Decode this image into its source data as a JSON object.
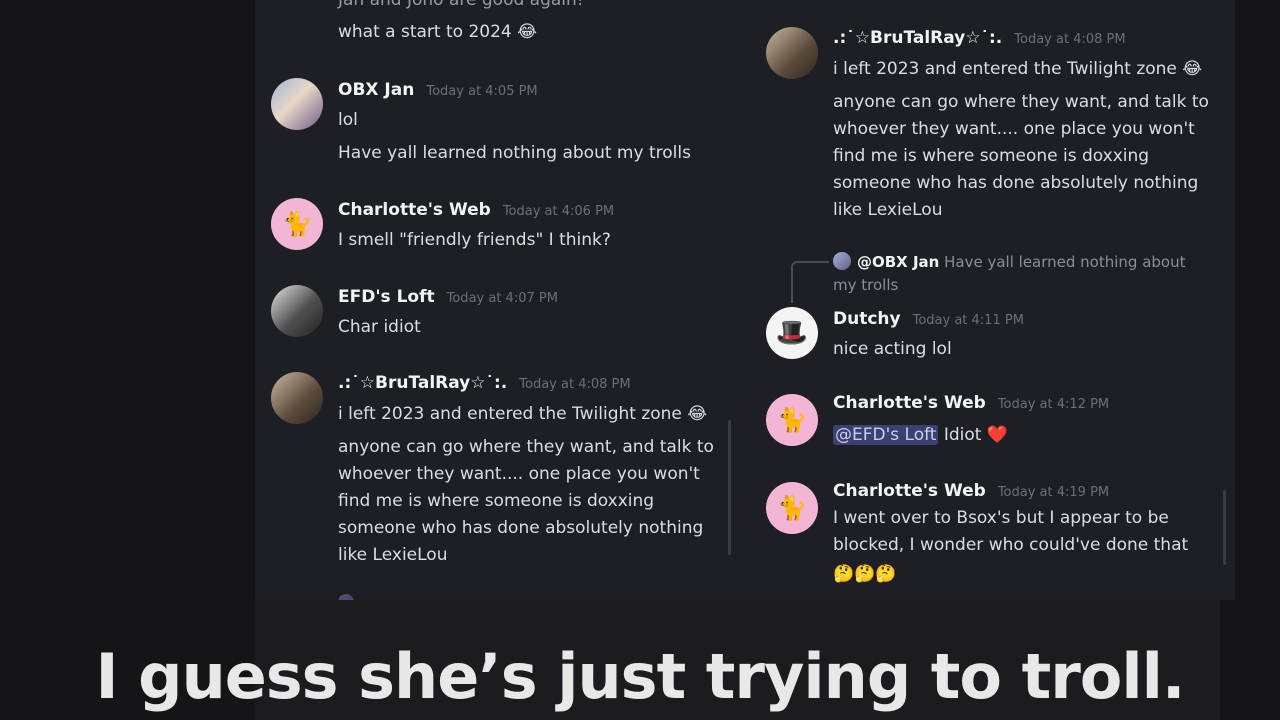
{
  "left_panel": {
    "top_partial": {
      "line1": "Jan and Jono are good again!",
      "line2": "what a start to 2024 😂"
    },
    "messages": [
      {
        "name": "OBX Jan",
        "time": "Today at 4:05 PM",
        "lines": [
          "lol",
          "Have yall learned nothing about my trolls"
        ]
      },
      {
        "name": "Charlotte's Web",
        "time": "Today at 4:06 PM",
        "lines": [
          "I smell \"friendly friends\" I think?"
        ]
      },
      {
        "name": "EFD's Loft",
        "time": "Today at 4:07 PM",
        "lines": [
          "Char idiot"
        ]
      },
      {
        "name": ".:˙☆BruTalRay☆˙:.",
        "time": "Today at 4:08 PM",
        "lines": [
          "i left 2023 and entered the Twilight zone 😂",
          "anyone can go where they want, and talk to",
          "whoever they want.... one place you won't",
          "find me is where someone is doxxing",
          "someone who has done absolutely nothing",
          "like LexieLou"
        ]
      }
    ]
  },
  "right_panel": {
    "messages": [
      {
        "name": ".:˙☆BruTalRay☆˙:.",
        "time": "Today at 4:08 PM",
        "lines": [
          "i left 2023 and entered the Twilight zone 😂",
          "anyone can go where they want, and talk to",
          "whoever they want.... one place you won't",
          "find me is where someone is doxxing",
          "someone who has done absolutely nothing",
          "like LexieLou"
        ]
      },
      {
        "reply": {
          "name": "@OBX Jan",
          "text1": "Have yall learned nothing about",
          "text2": "my trolls"
        },
        "name": "Dutchy",
        "time": "Today at 4:11 PM",
        "lines": [
          "nice acting lol"
        ]
      },
      {
        "name": "Charlotte's Web",
        "time": "Today at 4:12 PM",
        "mention": "@EFD's Loft",
        "after_mention": " Idiot ",
        "heart": "❤️"
      },
      {
        "name": "Charlotte's Web",
        "time": "Today at 4:19 PM",
        "lines": [
          "I went over to Bsox's but I appear to be",
          "blocked, I wonder who could've done that",
          "🤔🤔🤔"
        ]
      }
    ]
  },
  "caption": "I guess she’s just trying to troll.",
  "icons": {
    "cat": "cat-avatar-icon",
    "hat": "hat-avatar-icon"
  }
}
